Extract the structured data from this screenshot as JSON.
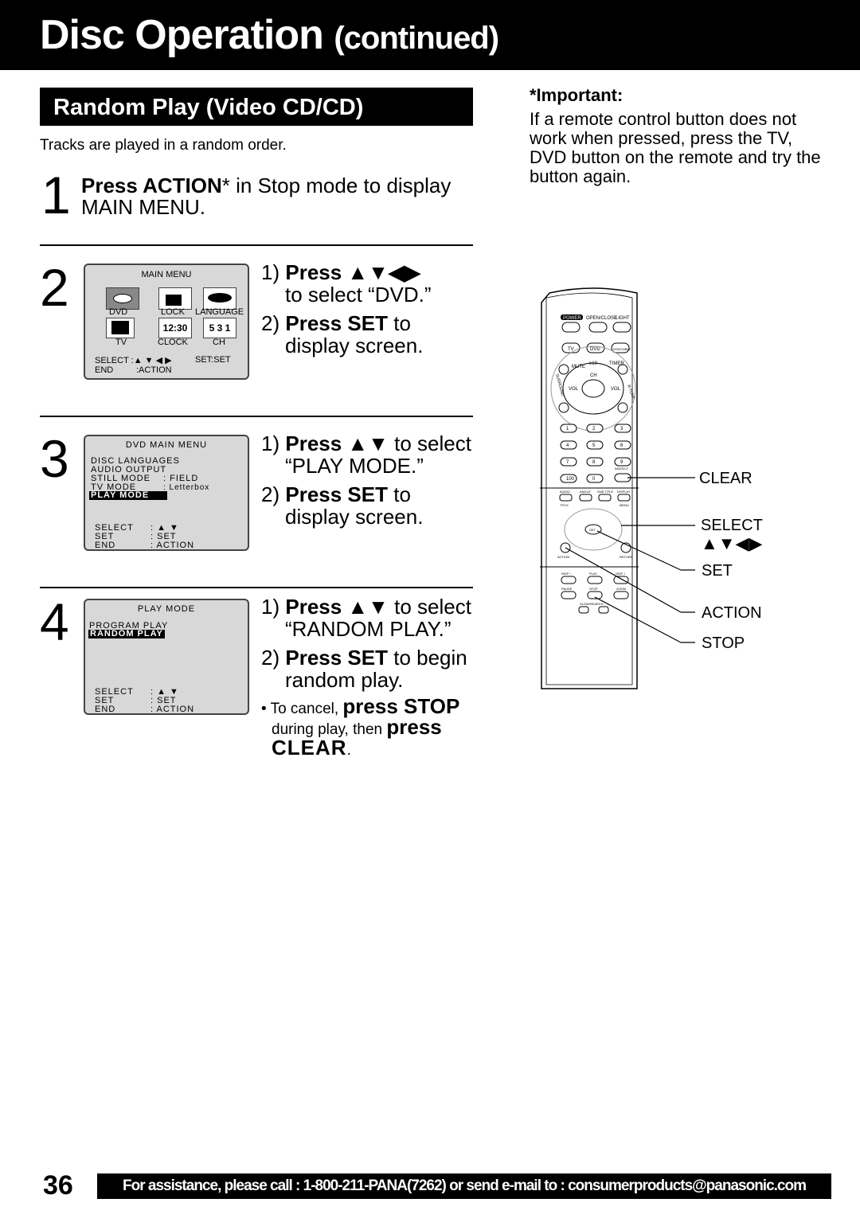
{
  "header": {
    "title": "Disc Operation",
    "subtitle": "(continued)"
  },
  "section": {
    "title": "Random Play (Video CD/CD)",
    "intro": "Tracks are played in a random order."
  },
  "step1": {
    "num": "1",
    "bold": "Press ACTION",
    "rest": "* in Stop mode to display",
    "line2": "MAIN MENU."
  },
  "step2": {
    "num": "2",
    "screen": {
      "title": "MAIN MENU",
      "icons": [
        "DVD",
        "LOCK",
        "LANGUAGE",
        "TV",
        "CLOCK",
        "CH"
      ],
      "clock": "12:30",
      "ch": "5 3 1",
      "select": "SELECT :▲ ▼ ◀ ▶",
      "set": "SET:SET",
      "end": "END",
      "end_val": ":ACTION"
    },
    "i1_n": "1)",
    "i1_b": "Press ▲▼◀▶",
    "i1_l2": "to select “DVD.”",
    "i2_n": "2)",
    "i2_b": "Press SET",
    "i2_r": " to",
    "i2_l2": "display screen."
  },
  "step3": {
    "num": "3",
    "screen": {
      "title": "DVD MAIN MENU",
      "rows": [
        "DISC LANGUAGES",
        "AUDIO OUTPUT",
        "STILL MODE",
        "TV MODE"
      ],
      "still_val": ": FIELD",
      "tv_val": ": Letterbox",
      "highlight": "PLAY MODE",
      "k1": "SELECT",
      "v1": ": ▲ ▼",
      "k2": "SET",
      "v2": ": SET",
      "k3": "END",
      "v3": ": ACTION"
    },
    "i1_n": "1)",
    "i1_b": "Press ▲▼",
    "i1_r": " to select",
    "i1_l2": "“PLAY MODE.”",
    "i2_n": "2)",
    "i2_b": "Press SET",
    "i2_r": " to",
    "i2_l2": "display screen."
  },
  "step4": {
    "num": "4",
    "screen": {
      "title": "PLAY MODE",
      "row": "PROGRAM PLAY",
      "highlight": "RANDOM PLAY",
      "k1": "SELECT",
      "v1": ": ▲ ▼",
      "k2": "SET",
      "v2": ": SET",
      "k3": "END",
      "v3": ": ACTION"
    },
    "i1_n": "1)",
    "i1_b": "Press ▲▼",
    "i1_r": " to select",
    "i1_l2": "“RANDOM PLAY.”",
    "i2_n": "2)",
    "i2_b": "Press SET",
    "i2_r": " to begin",
    "i2_l2": "random play.",
    "note_a": "• To cancel, ",
    "note_b": "press STOP",
    "note_c": "during play, then ",
    "note_d": "press",
    "note_e": "CLEAR",
    "note_f": "."
  },
  "important": {
    "title": "*Important:",
    "body": "If a remote control button does not work when pressed, press the TV, DVD button on the remote and try the button again."
  },
  "remote": {
    "buttons": {
      "power": "POWER",
      "openclose": "OPEN/CLOSE",
      "light": "LIGHT",
      "tv": "TV",
      "dvd": "DVD",
      "dss": "DSS/CABLE",
      "ch": "CH",
      "vol": "VOL",
      "mute": "MUTE",
      "timer": "TIMER",
      "surround": "SURROUND",
      "rtune": "R-TUNE",
      "ge10": "≥10",
      "digits": [
        "1",
        "2",
        "3",
        "4",
        "5",
        "6",
        "7",
        "8",
        "9",
        "100",
        "0"
      ],
      "adddlt": "ADD/DLT",
      "audio": "AUDIO",
      "angle": "ANGLE",
      "subtitle": "SUB TITLE",
      "display": "DISPLAY",
      "title": "TITLE",
      "menu": "MENU",
      "set": "SET",
      "action": "ACTION",
      "return": "RETURN",
      "skipm": "SKIP −",
      "play": "PLAY",
      "skipp": "SKIP +",
      "pause": "PAUSE",
      "stop": "STOP",
      "zoom": "ZOOM",
      "slow": "SLOW/SEARCH"
    },
    "callouts": {
      "clear": "CLEAR",
      "select": "SELECT",
      "arrows": "▲▼◀▶",
      "set": "SET",
      "action": "ACTION",
      "stop": "STOP"
    }
  },
  "footer": {
    "page": "36",
    "assist": "For assistance, please call : 1-800-211-PANA(7262) or send e-mail to : consumerproducts@panasonic.com"
  }
}
